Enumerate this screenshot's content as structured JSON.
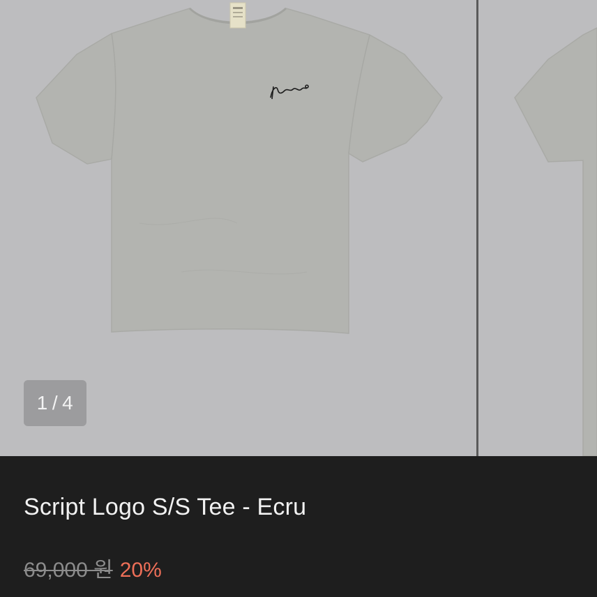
{
  "gallery": {
    "current_index": "1",
    "separator": "/",
    "total": "4",
    "brand_logo_alt": "script logo embroidery",
    "background_color": "#bdbdbf",
    "shirt_color": "#b3b4b0"
  },
  "product": {
    "title": "Script Logo S/S Tee - Ecru",
    "original_price": "69,000 원",
    "discount": "20%",
    "discount_color": "#ee6f58"
  }
}
